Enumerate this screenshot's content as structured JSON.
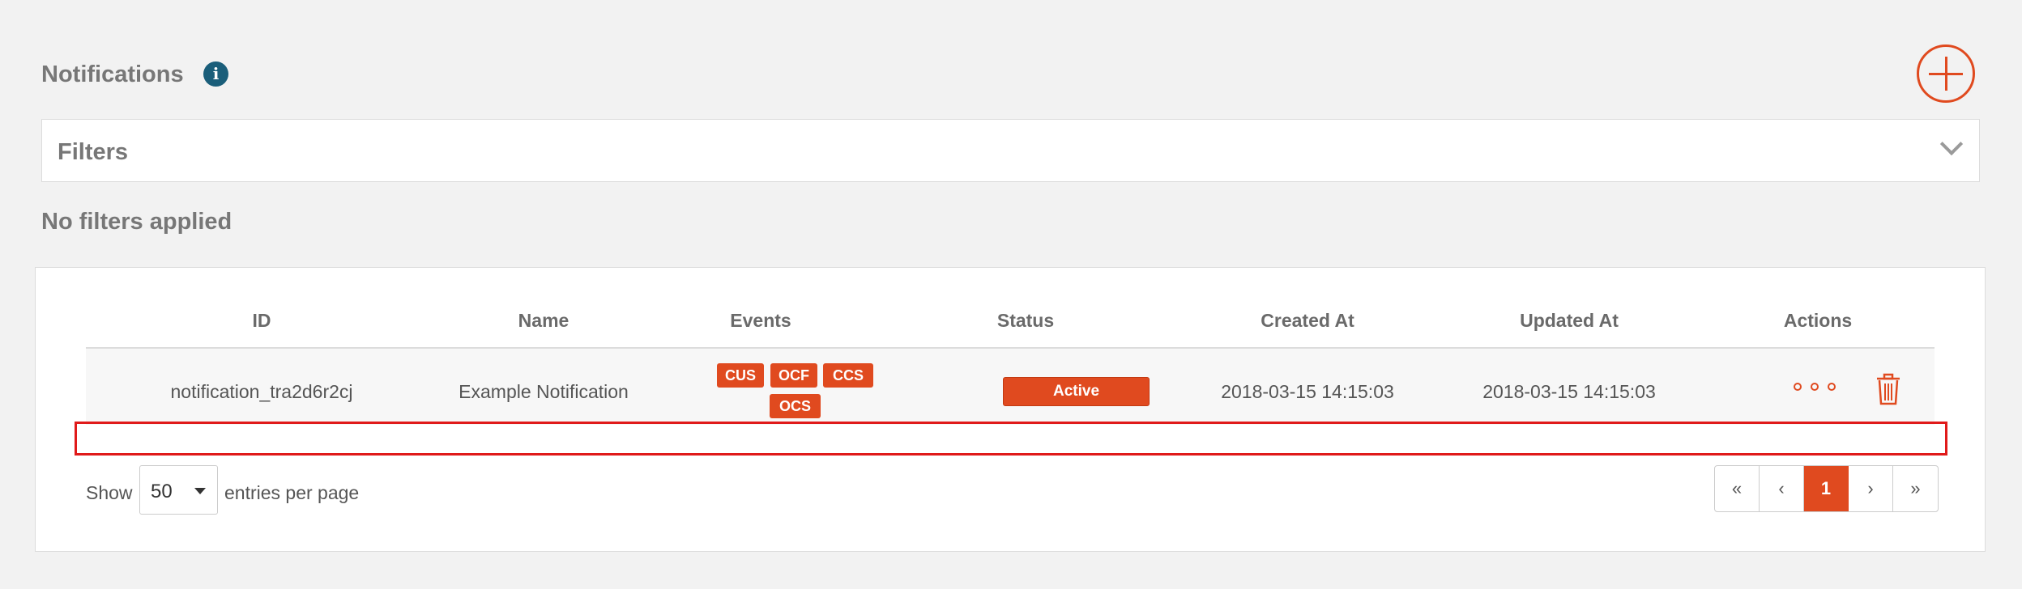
{
  "header": {
    "title": "Notifications"
  },
  "filters": {
    "label": "Filters",
    "status": "No filters applied"
  },
  "table": {
    "columns": [
      "ID",
      "Name",
      "Events",
      "Status",
      "Created At",
      "Updated At",
      "Actions"
    ],
    "rows": [
      {
        "id": "notification_tra2d6r2cj",
        "name": "Example Notification",
        "events": [
          "CUS",
          "OCF",
          "CCS",
          "OCS"
        ],
        "status": "Active",
        "created_at": "2018-03-15 14:15:03",
        "updated_at": "2018-03-15 14:15:03"
      }
    ]
  },
  "footer": {
    "show_label": "Show",
    "page_size": "50",
    "entries_label": "entries per page"
  },
  "pagination": {
    "first": "«",
    "prev": "‹",
    "current": "1",
    "next": "›",
    "last": "»"
  },
  "colors": {
    "accent": "#e04a1f",
    "info": "#1a5e7a",
    "highlight": "#e01a1a"
  }
}
